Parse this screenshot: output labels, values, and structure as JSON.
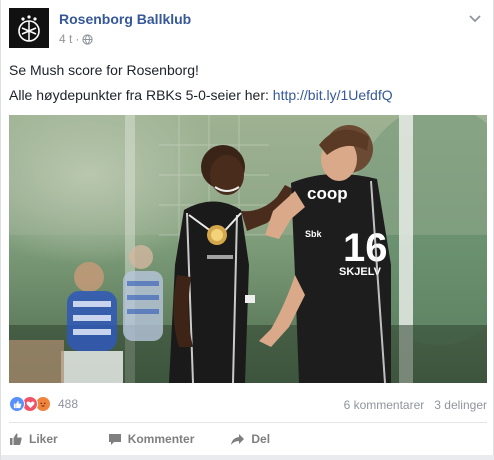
{
  "post": {
    "page_name": "Rosenborg Ballklub",
    "time": "4 t",
    "separator": "·",
    "globe_icon": "globe-icon",
    "text_line1": "Se Mush score for Rosenborg!",
    "text_line2_prefix": "Alle høydepunkter fra RBKs 5-0-seier her:",
    "link": "http://bit.ly/1UefdfQ",
    "photo_icon": "soccer-players-photo",
    "photo_print": {
      "sponsor": "coop",
      "number": "16",
      "player_name": "SKJELV",
      "kit_brand": "Sbk"
    }
  },
  "stats": {
    "reaction_icons": [
      "like-icon",
      "love-icon",
      "angry-icon"
    ],
    "reaction_count": "488",
    "comments": "6 kommentarer",
    "shares": "3 delinger"
  },
  "actions": {
    "like_label": "Liker",
    "comment_label": "Kommenter",
    "share_label": "Del"
  },
  "colors": {
    "link": "#365899",
    "like_blue": "#5890ff",
    "love_red": "#f25268",
    "angry_orange": "#f0843c",
    "muted": "#90949c"
  }
}
